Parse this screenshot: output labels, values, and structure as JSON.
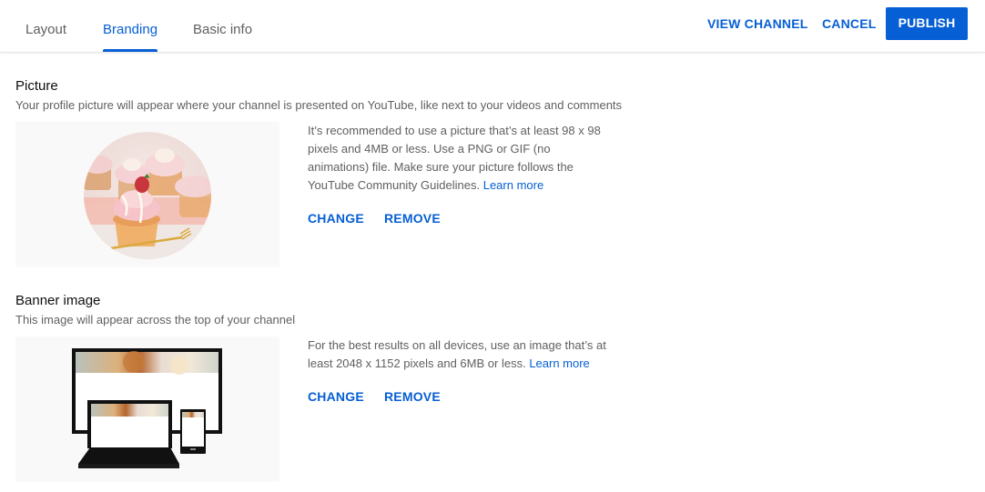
{
  "header": {
    "tabs": [
      {
        "label": "Layout",
        "active": false
      },
      {
        "label": "Branding",
        "active": true
      },
      {
        "label": "Basic info",
        "active": false
      }
    ],
    "view_channel_label": "VIEW CHANNEL",
    "cancel_label": "CANCEL",
    "publish_label": "PUBLISH"
  },
  "picture": {
    "title": "Picture",
    "description": "Your profile picture will appear where your channel is presented on YouTube, like next to your videos and comments",
    "preview_icon": "cupcakes-profile-image",
    "info_text": "It’s recommended to use a picture that’s at least 98 x 98 pixels and 4MB or less. Use a PNG or GIF (no animations) file. Make sure your picture follows the YouTube Community Guidelines.",
    "learn_more": "Learn more",
    "change_label": "CHANGE",
    "remove_label": "REMOVE"
  },
  "banner": {
    "title": "Banner image",
    "description": "This image will appear across the top of your channel",
    "preview_icon": "devices-banner-preview",
    "info_text": "For the best results on all devices, use an image that’s at least 2048 x 1152 pixels and 6MB or less.",
    "learn_more": "Learn more",
    "change_label": "CHANGE",
    "remove_label": "REMOVE"
  },
  "colors": {
    "accent": "#065fd4",
    "secondary_text": "#606060",
    "preview_bg": "#f9f9f9"
  }
}
